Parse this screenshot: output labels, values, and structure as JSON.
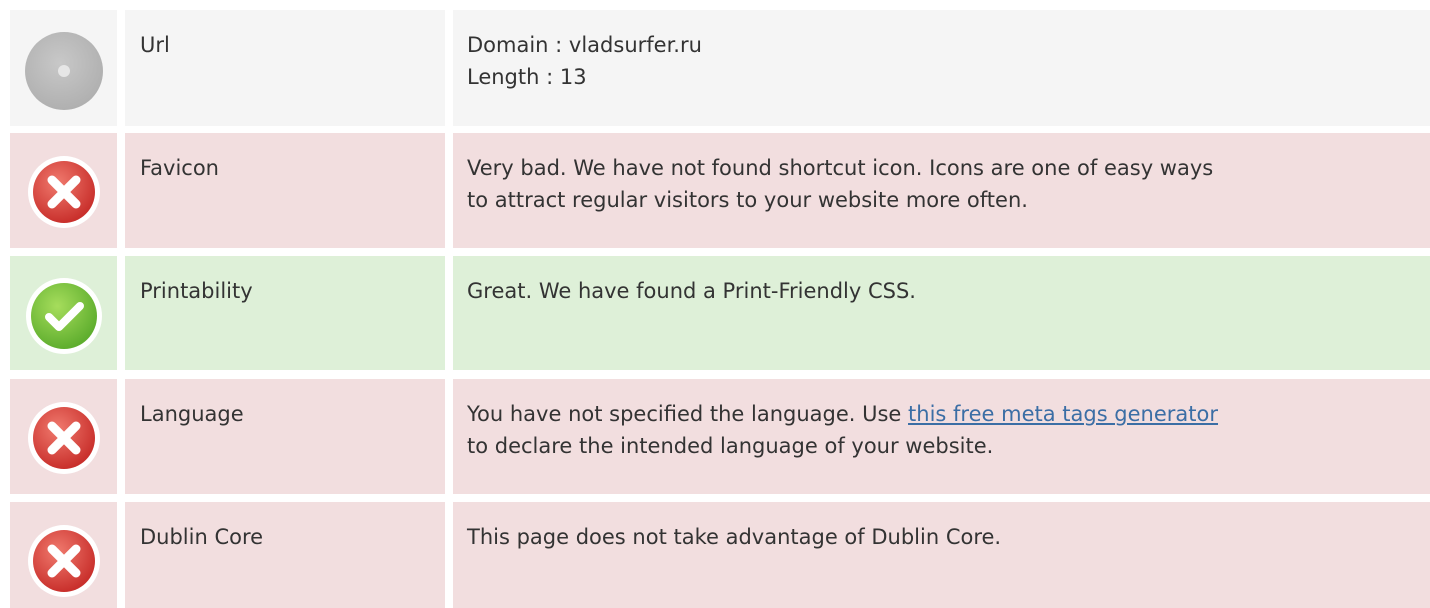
{
  "rows": [
    {
      "status": "neutral",
      "icon": "neutral-circle-icon",
      "label": "Url",
      "lines": [
        "Domain : vladsurfer.ru",
        "Length : 13"
      ]
    },
    {
      "status": "bad",
      "icon": "error-x-icon",
      "label": "Favicon",
      "lines": [
        "Very bad. We have not found shortcut icon. Icons are one of easy ways",
        "to attract regular visitors to your website more often."
      ]
    },
    {
      "status": "good",
      "icon": "check-icon",
      "label": "Printability",
      "lines": [
        "Great. We have found a Print-Friendly CSS."
      ]
    },
    {
      "status": "bad",
      "icon": "error-x-icon",
      "label": "Language",
      "text_before_link": "You have not specified the language. Use ",
      "link_text": "this free meta tags generator",
      "text_after_link": "to declare the intended language of your website."
    },
    {
      "status": "bad",
      "icon": "error-x-icon",
      "label": "Dublin Core",
      "lines": [
        "This page does not take advantage of Dublin Core."
      ]
    }
  ],
  "colors": {
    "neutral_bg": "#f5f5f5",
    "bad_bg": "#f2dedf",
    "good_bg": "#def0d8",
    "error_red": "#d9534f",
    "success_green": "#7cc143",
    "link": "#3b6ea5"
  }
}
